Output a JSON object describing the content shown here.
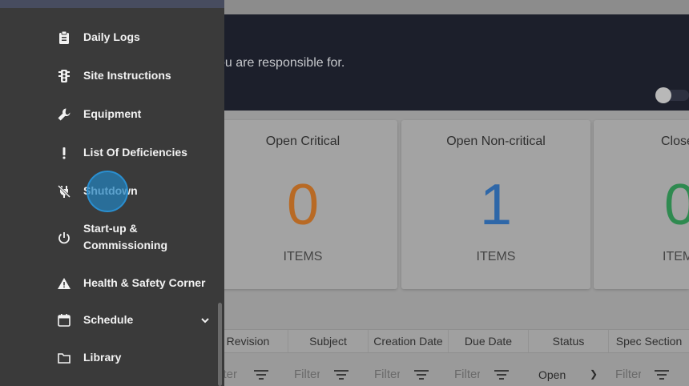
{
  "banner": {
    "text": "ou are responsible for."
  },
  "cards": [
    {
      "title": "Open Critical",
      "count": "0",
      "unit": "ITEMS",
      "color": "#b86a25"
    },
    {
      "title": "Open Non-critical",
      "count": "1",
      "unit": "ITEMS",
      "color": "#2e67a8"
    },
    {
      "title": "Close",
      "count": "0",
      "unit": "ITEM",
      "color": "#2f8a50"
    }
  ],
  "table": {
    "headers": [
      "Revision",
      "Subject",
      "Creation Date",
      "Due Date",
      "Status",
      "Spec Section"
    ],
    "filter_placeholder": "Filter",
    "status_filter_value": "Open"
  },
  "sidebar": {
    "items": [
      {
        "label": "Daily Logs",
        "icon": "clipboard-icon"
      },
      {
        "label": "Site Instructions",
        "icon": "traffic-light-icon"
      },
      {
        "label": "Equipment",
        "icon": "wrench-icon"
      },
      {
        "label": "List Of Deficiencies",
        "icon": "exclamation-icon"
      },
      {
        "label": "Shutdown",
        "icon": "plug-off-icon"
      },
      {
        "label": "Start-up &",
        "label2": "Commissioning",
        "icon": "power-icon"
      },
      {
        "label": "Health & Safety Corner",
        "icon": "warning-icon"
      },
      {
        "label": "Schedule",
        "icon": "calendar-icon"
      },
      {
        "label": "Library",
        "icon": "folder-icon"
      }
    ]
  },
  "colors": {
    "sidebar_bg": "#3a3a3a",
    "banner_bg": "#1c1f2b",
    "click_indicator": "#2a8fd0"
  }
}
